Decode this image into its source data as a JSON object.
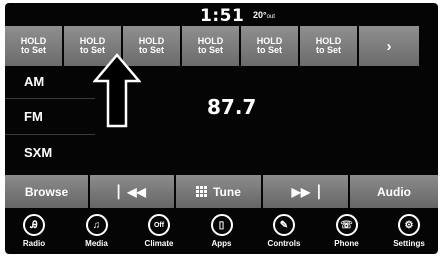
{
  "status": {
    "time": "1:51",
    "temp": "20°",
    "temp_unit": "out"
  },
  "presets": [
    {
      "line1": "HOLD",
      "line2": "to Set"
    },
    {
      "line1": "HOLD",
      "line2": "to Set"
    },
    {
      "line1": "HOLD",
      "line2": "to Set"
    },
    {
      "line1": "HOLD",
      "line2": "to Set"
    },
    {
      "line1": "HOLD",
      "line2": "to Set"
    },
    {
      "line1": "HOLD",
      "line2": "to Set"
    }
  ],
  "presets_next_icon": "chevron-right-icon",
  "sources": {
    "am": "AM",
    "fm": "FM",
    "sxm": "SXM"
  },
  "frequency": "87.7",
  "controls": {
    "browse": "Browse",
    "tune": "Tune",
    "audio": "Audio"
  },
  "nav": [
    {
      "label": "Radio",
      "icon": "radio-icon"
    },
    {
      "label": "Media",
      "icon": "media-icon"
    },
    {
      "label": "Climate",
      "icon": "climate-icon",
      "glyph": "Off"
    },
    {
      "label": "Apps",
      "icon": "apps-icon"
    },
    {
      "label": "Controls",
      "icon": "controls-icon"
    },
    {
      "label": "Phone",
      "icon": "phone-icon"
    },
    {
      "label": "Settings",
      "icon": "settings-icon"
    }
  ]
}
